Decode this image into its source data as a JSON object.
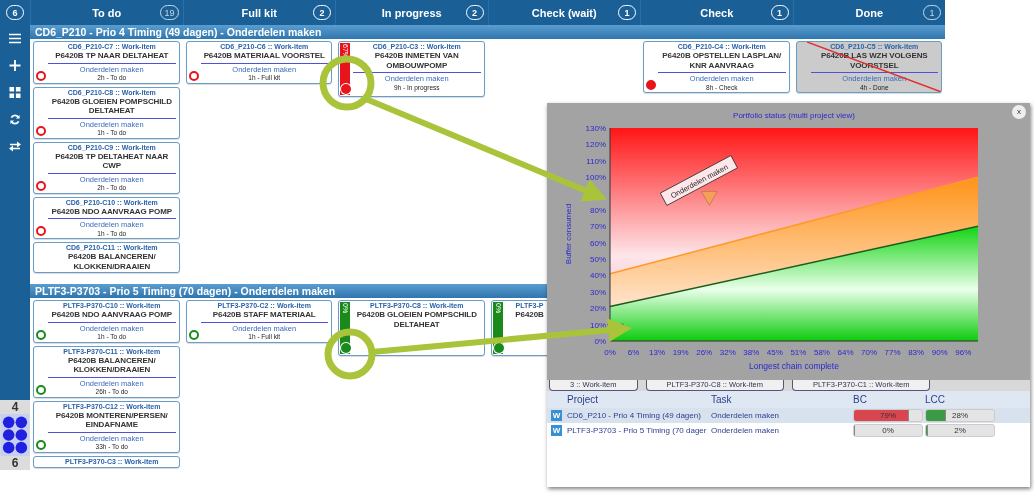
{
  "header": {
    "corner_count": "6",
    "columns": [
      {
        "title": "To do",
        "count": "19",
        "dimmed": true
      },
      {
        "title": "Full kit",
        "count": "2",
        "dimmed": false
      },
      {
        "title": "In progress",
        "count": "2",
        "dimmed": false
      },
      {
        "title": "Check (wait)",
        "count": "1",
        "dimmed": false
      },
      {
        "title": "Check",
        "count": "1",
        "dimmed": false
      },
      {
        "title": "Done",
        "count": "1",
        "dimmed": true
      }
    ]
  },
  "sidebar": {
    "upper_label": "4",
    "lower_label": "6"
  },
  "lanes": [
    {
      "title": "CD6_P210 - Prio 4 Timing (49 dagen) - Onderdelen maken",
      "columns": [
        [
          {
            "id": "CD6_P210-C7 :: Work-item",
            "title": "P6420B TP NAAR DELTAHEAT",
            "task": "Onderdelen maken",
            "meta": "2h - To do",
            "color": "#e8141c",
            "filled": false,
            "done": false
          },
          {
            "id": "CD6_P210-C8 :: Work-item",
            "title": "P6420B GLOEIEN POMPSCHILD DELTAHEAT",
            "task": "Onderdelen maken",
            "meta": "1h - To do",
            "color": "#e8141c",
            "filled": false,
            "done": false
          },
          {
            "id": "CD6_P210-C9 :: Work-item",
            "title": "P6420B TP DELTAHEAT NAAR CWP",
            "task": "Onderdelen maken",
            "meta": "2h - To do",
            "color": "#e8141c",
            "filled": false,
            "done": false
          },
          {
            "id": "CD6_P210-C10 :: Work-item",
            "title": "P6420B  NDO AANVRAAG POMP",
            "task": "Onderdelen maken",
            "meta": "1h - To do",
            "color": "#e8141c",
            "filled": false,
            "done": false
          },
          {
            "id": "CD6_P210-C11 :: Work-item",
            "title": "P6420B BALANCEREN/ KLOKKEN/DRAAIEN",
            "done": false
          }
        ],
        [
          {
            "id": "CD6_P210-C6 :: Work-item",
            "title": "P6420B MATERIAAL VOORSTEL",
            "task": "Onderdelen maken",
            "meta": "1h - Full kit",
            "color": "#e8141c",
            "filled": false,
            "done": false
          }
        ],
        [
          {
            "id": "CD6_P210-C3 :: Work-item",
            "title": "P6420B INMETEN VAN OMBOUWPOMP",
            "task": "Onderdelen maken",
            "meta": "9h - In progress",
            "color": "#e8141c",
            "filled": true,
            "done": false,
            "bar": {
              "label": "67%",
              "color": "#e8141c"
            }
          }
        ],
        [],
        [
          {
            "id": "CD6_P210-C4 :: Work-item",
            "title": "P6420B OPSTELLEN LASPLAN/ KNR AANVRAAG",
            "task": "Onderdelen maken",
            "meta": "8h - Check",
            "color": "#e8141c",
            "filled": true,
            "done": false
          }
        ],
        [
          {
            "id": "CD6_P210-C5 :: Work-item",
            "title": "P6420B LAS WZH VOLGENS VOORSTSEL",
            "task": "Onderdelen maken",
            "meta": "4h - Done",
            "done": true
          }
        ]
      ]
    },
    {
      "title": "PLTF3-P3703 - Prio 5 Timing (70 dagen) - Onderdelen maken",
      "columns": [
        [
          {
            "id": "PLTF3-P370-C10 :: Work-item",
            "title": "P6420B  NDO AANVRAAG POMP",
            "task": "Onderdelen maken",
            "meta": "1h - To do",
            "color": "#1a8a1a",
            "filled": false,
            "done": false
          },
          {
            "id": "PLTF3-P370-C11 :: Work-item",
            "title": "P6420B BALANCEREN/ KLOKKEN/DRAAIEN",
            "task": "Onderdelen maken",
            "meta": "26h - To do",
            "color": "#1a8a1a",
            "filled": false,
            "done": false
          },
          {
            "id": "PLTF3-P370-C12 :: Work-item",
            "title": "P6420B MONTEREN/PERSEN/ EINDAFNAME",
            "task": "Onderdelen maken",
            "meta": "33h - To do",
            "color": "#1a8a1a",
            "filled": false,
            "done": false
          },
          {
            "id": "PLTF3-P370-C3 :: Work-item",
            "done": false
          }
        ],
        [
          {
            "id": "PLTF3-P370-C2 :: Work-item",
            "title": "P6420B STAFF MATERIAAL",
            "task": "Onderdelen maken",
            "meta": "1h - Full kit",
            "color": "#1a8a1a",
            "filled": false,
            "done": false
          }
        ],
        [
          {
            "id": "PLTF3-P370-C8 :: Work-item",
            "title": "P6420B GLOEIEN POMPSCHILD DELTAHEAT",
            "color": "#1a8a1a",
            "filled": true,
            "done": false,
            "bar": {
              "label": "0%",
              "color": "#1a8a1a"
            }
          }
        ],
        [
          {
            "id": "PLTF3-P",
            "title": "P6420B",
            "color": "#1a8a1a",
            "filled": true,
            "done": false,
            "bar": {
              "label": "0%",
              "color": "#1a8a1a"
            }
          }
        ],
        [],
        []
      ]
    }
  ],
  "popup": {
    "close_label": "x",
    "chart_data": {
      "type": "area",
      "title": "Portfolio status (multi project view)",
      "xlabel": "Longest chain complete",
      "ylabel": "Buffer consumed",
      "x": [
        0,
        100
      ],
      "xlim": [
        0,
        100
      ],
      "ylim": [
        0,
        130
      ],
      "xticks": [
        {
          "value": 0,
          "label": "0%"
        },
        {
          "value": 6.4,
          "label": "6%"
        },
        {
          "value": 12.8,
          "label": "13%"
        },
        {
          "value": 19.2,
          "label": "19%"
        },
        {
          "value": 25.6,
          "label": "26%"
        },
        {
          "value": 32,
          "label": "32%"
        },
        {
          "value": 38.4,
          "label": "38%"
        },
        {
          "value": 44.8,
          "label": "45%"
        },
        {
          "value": 51.2,
          "label": "51%"
        },
        {
          "value": 57.6,
          "label": "58%"
        },
        {
          "value": 64,
          "label": "64%"
        },
        {
          "value": 70.4,
          "label": "70%"
        },
        {
          "value": 76.8,
          "label": "77%"
        },
        {
          "value": 83.2,
          "label": "83%"
        },
        {
          "value": 89.6,
          "label": "90%"
        },
        {
          "value": 96,
          "label": "96%"
        }
      ],
      "yticks": [
        {
          "value": 0,
          "label": "0%"
        },
        {
          "value": 10,
          "label": "10%"
        },
        {
          "value": 20,
          "label": "20%"
        },
        {
          "value": 30,
          "label": "30%"
        },
        {
          "value": 40,
          "label": "40%"
        },
        {
          "value": 50,
          "label": "50%"
        },
        {
          "value": 60,
          "label": "60%"
        },
        {
          "value": 70,
          "label": "70%"
        },
        {
          "value": 80,
          "label": "80%"
        },
        {
          "value": 100,
          "label": "100%"
        },
        {
          "value": 110,
          "label": "110%"
        },
        {
          "value": 120,
          "label": "120%"
        },
        {
          "value": 130,
          "label": "130%"
        }
      ],
      "series": [
        {
          "color": "#1c5c1c",
          "values": [
            21,
            70
          ]
        },
        {
          "color": "#ff9a2a",
          "values": [
            41,
            100
          ]
        }
      ],
      "annotations": [
        "Onderdelen maken"
      ]
    },
    "strip_items": [
      "3 :: Work-item",
      "PLTF3-P370-C8 :: Work-item",
      "PLTF3-P370-C1 :: Work-item"
    ],
    "table": {
      "columns": [
        "Project",
        "Task",
        "BC",
        "LCC"
      ],
      "rows": [
        {
          "badge": "W",
          "project": "CD6_P210 - Prio 4 Timing (49 dagen)",
          "task": "Onderdelen maken",
          "bc": {
            "level": 0.79,
            "reading": "79%"
          },
          "lcc": {
            "level": 0.28,
            "reading": "28%"
          },
          "selected": true
        },
        {
          "badge": "W",
          "project": "PLTF3-P3703 - Prio 5 Timing (70 dager",
          "task": "Onderdelen maken",
          "bc": {
            "level": 0,
            "reading": "0%"
          },
          "lcc": {
            "level": 0.02,
            "reading": "2%"
          },
          "selected": false
        }
      ]
    }
  }
}
